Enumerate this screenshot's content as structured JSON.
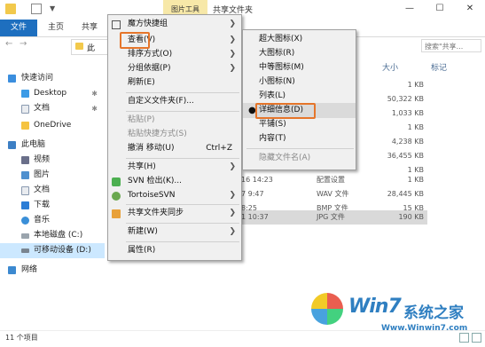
{
  "titlebar": {
    "context_tab": "图片工具",
    "title": "共享文件夹",
    "minimize": "—",
    "maximize": "☐",
    "close": "✕",
    "qa_dropdown": "▼"
  },
  "ribbon": {
    "tabs": [
      "文件",
      "主页",
      "共享"
    ]
  },
  "address": {
    "path": "此",
    "search_placeholder": "搜索\"共享...",
    "back": "←",
    "forward": "→"
  },
  "nav": {
    "items": [
      {
        "label": "快速访问",
        "icon": "star-icon",
        "pinned": false
      },
      {
        "label": "Desktop",
        "icon": "desktop-icon",
        "pinned": true
      },
      {
        "label": "文档",
        "icon": "document-icon",
        "pinned": true
      },
      {
        "label": "OneDrive",
        "icon": "cloud-icon",
        "pinned": false
      },
      {
        "label": "此电脑",
        "icon": "computer-icon",
        "pinned": false
      },
      {
        "label": "视频",
        "icon": "video-icon",
        "pinned": false
      },
      {
        "label": "图片",
        "icon": "pictures-icon",
        "pinned": false
      },
      {
        "label": "文档",
        "icon": "document-icon",
        "pinned": false
      },
      {
        "label": "下载",
        "icon": "download-icon",
        "pinned": false
      },
      {
        "label": "音乐",
        "icon": "music-icon",
        "pinned": false
      },
      {
        "label": "本地磁盘 (C:)",
        "icon": "drive-icon",
        "pinned": false
      },
      {
        "label": "可移动设备 (D:)",
        "icon": "removable-drive-icon",
        "pinned": false
      },
      {
        "label": "网络",
        "icon": "network-icon",
        "pinned": false
      }
    ],
    "pin_glyph": "✱"
  },
  "list": {
    "columns": {
      "size": "大小",
      "tags": "标记"
    },
    "rows": [
      {
        "date": "",
        "type": "",
        "size": "1 KB"
      },
      {
        "date": "",
        "type": "",
        "size": "50,322 KB"
      },
      {
        "date": "",
        "type": "",
        "size": "1,033 KB"
      },
      {
        "date": "",
        "type": "",
        "size": "1 KB"
      },
      {
        "date": "",
        "type": "",
        "size": "4,238 KB"
      },
      {
        "date": "",
        "type": "",
        "size": "36,455 KB"
      },
      {
        "date": "",
        "type": "",
        "size": "1 KB"
      },
      {
        "date": "16 14:23",
        "type": "配置设置",
        "size": "1 KB"
      },
      {
        "date": "7 9:47",
        "type": "WAV 文件",
        "size": "28,445 KB"
      },
      {
        "date": "8:25",
        "type": "BMP 文件",
        "size": "15 KB"
      },
      {
        "date": "1 10:37",
        "type": "JPG 文件",
        "size": "190 KB"
      }
    ]
  },
  "status": {
    "count": "11 个项目"
  },
  "menu1": {
    "items": [
      {
        "label": "魔方快捷组",
        "arrow": true,
        "icon": "grid-icon"
      },
      {
        "label": "查看(V)",
        "arrow": true
      },
      {
        "label": "排序方式(O)",
        "arrow": true
      },
      {
        "label": "分组依据(P)",
        "arrow": true
      },
      {
        "label": "刷新(E)"
      },
      {
        "label": "自定义文件夹(F)..."
      },
      {
        "label": "粘贴(P)",
        "disabled": true
      },
      {
        "label": "粘贴快捷方式(S)",
        "disabled": true
      },
      {
        "label": "撤消 移动(U)",
        "shortcut": "Ctrl+Z"
      },
      {
        "label": "共享(H)",
        "arrow": true
      },
      {
        "label": "SVN 检出(K)...",
        "icon": "svn-checkout-icon"
      },
      {
        "label": "TortoiseSVN",
        "arrow": true,
        "icon": "tortoisesvn-icon"
      },
      {
        "label": "共享文件夹同步",
        "arrow": true,
        "icon": "sync-icon"
      },
      {
        "label": "新建(W)",
        "arrow": true
      },
      {
        "label": "属性(R)"
      }
    ],
    "arrow_glyph": "❯"
  },
  "menu2": {
    "items": [
      {
        "label": "超大图标(X)"
      },
      {
        "label": "大图标(R)"
      },
      {
        "label": "中等图标(M)"
      },
      {
        "label": "小图标(N)"
      },
      {
        "label": "列表(L)"
      },
      {
        "label": "详细信息(D)",
        "checked": true
      },
      {
        "label": "平铺(S)"
      },
      {
        "label": "内容(T)"
      },
      {
        "label": "隐藏文件名(A)",
        "disabled": true
      }
    ],
    "bullet": "●"
  },
  "watermark": {
    "brand_en": "Win7",
    "brand_cn": "系统之家",
    "url": "Www.Winwin7.com"
  },
  "colors": {
    "accent": "#1e6fbf",
    "highlight_box": "#e5752a",
    "nav_selected": "#cce8ff"
  }
}
